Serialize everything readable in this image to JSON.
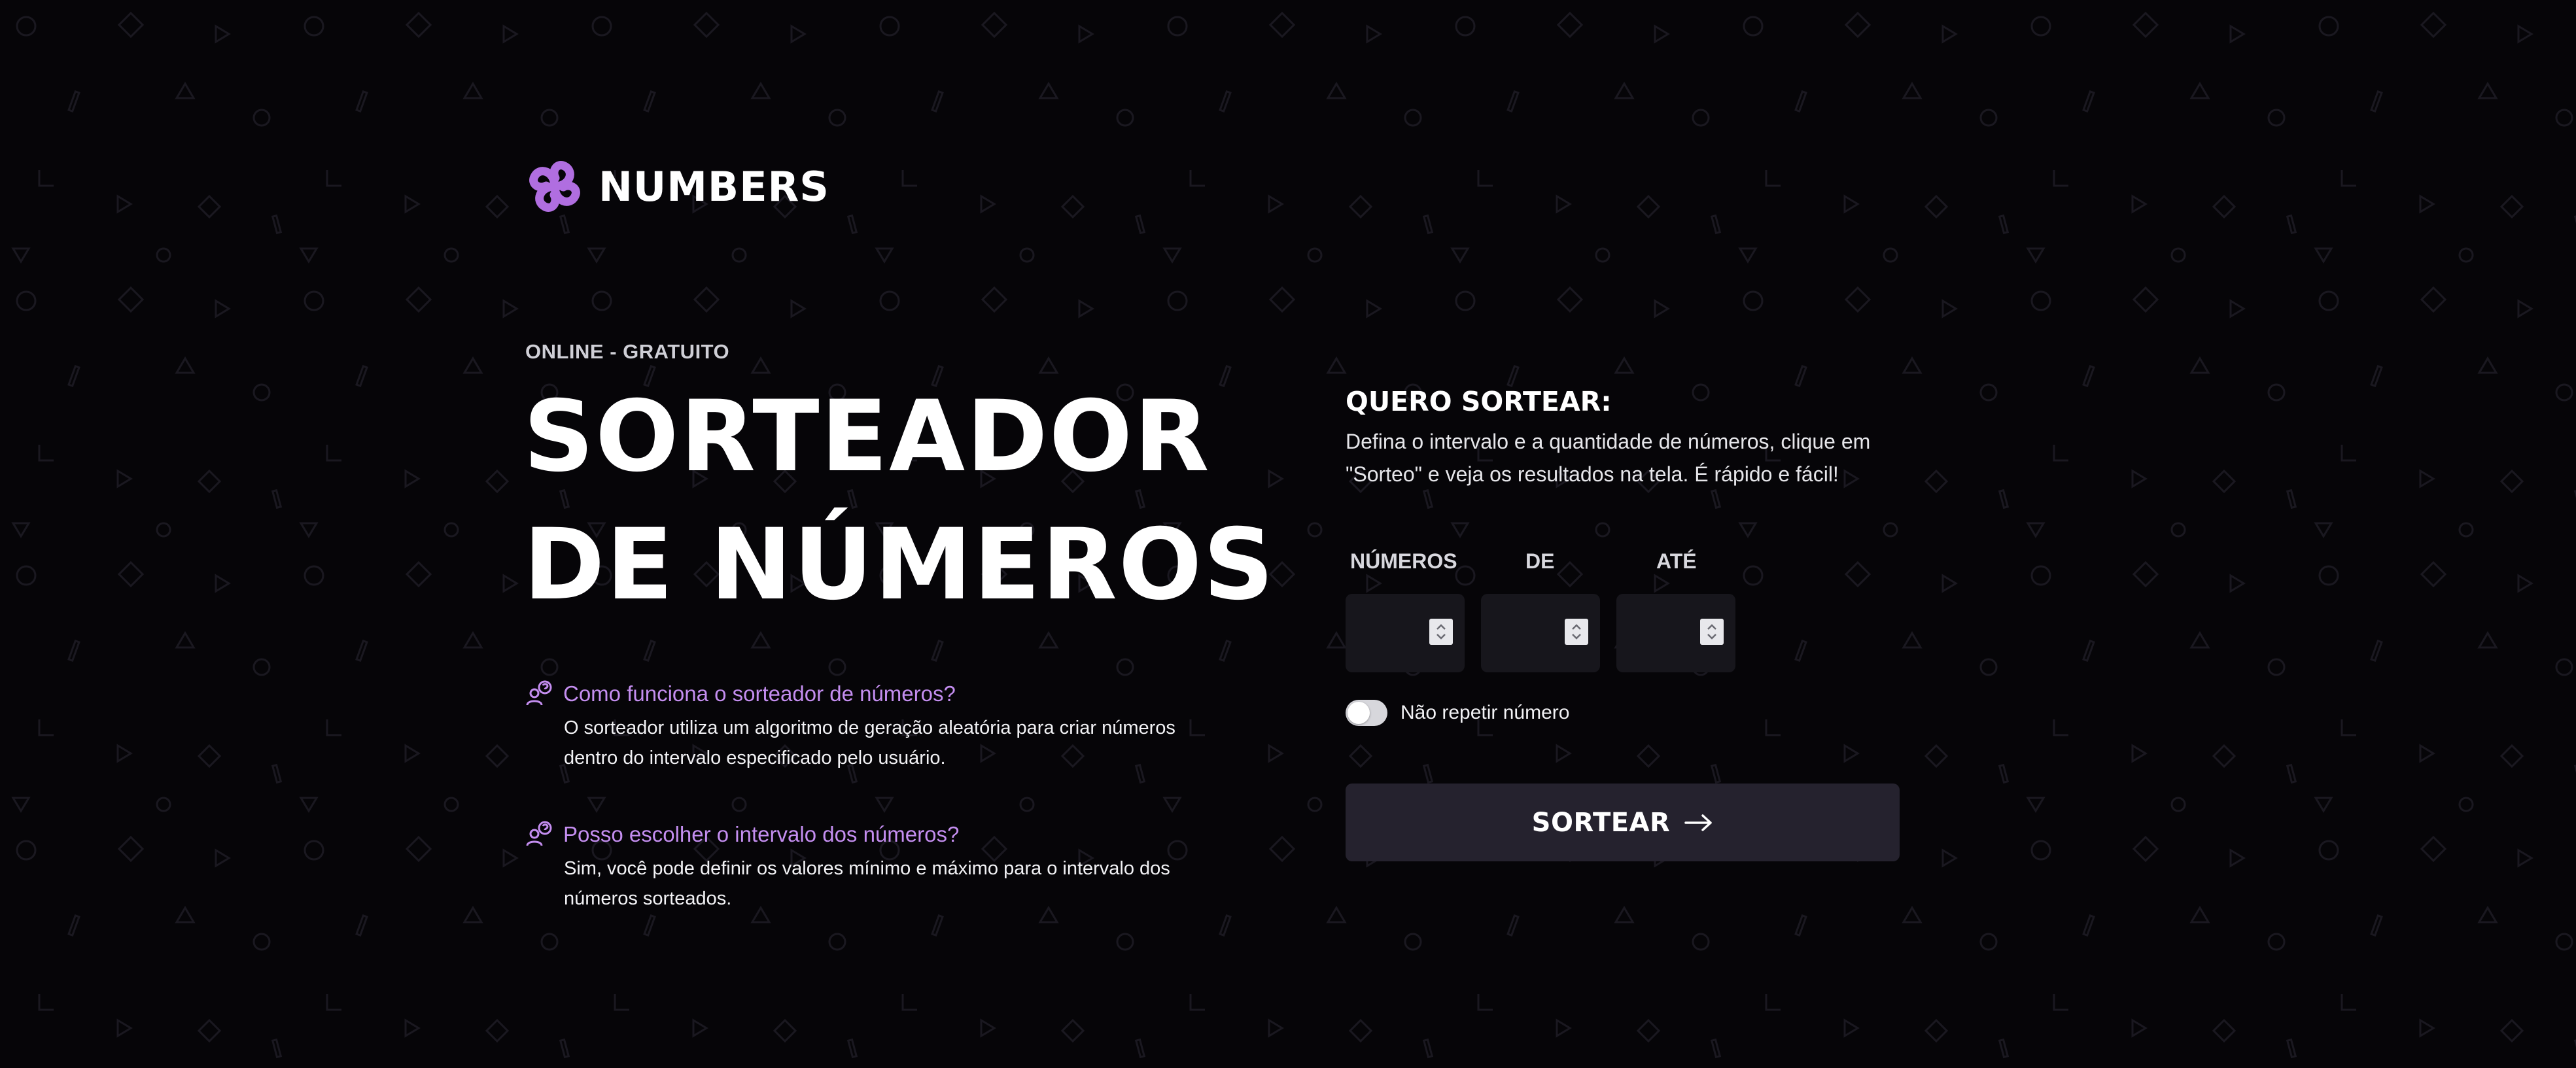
{
  "brand": {
    "name": "NUMBERS",
    "accent_color": "#b06ee0"
  },
  "hero": {
    "eyebrow": "ONLINE - GRATUITO",
    "title_line1": "SORTEADOR",
    "title_line2": "DE NÚMEROS"
  },
  "faq": [
    {
      "question": "Como funciona o sorteador de números?",
      "answer_line1": "O sorteador utiliza um algoritmo de geração aleatória para criar números",
      "answer_line2": "dentro do intervalo especificado pelo usuário.",
      "icon": "people-question-icon"
    },
    {
      "question": "Posso escolher o intervalo dos números?",
      "answer_line1": "Sim, você pode definir os valores mínimo e máximo para o intervalo dos",
      "answer_line2": "números sorteados.",
      "icon": "people-question-icon"
    }
  ],
  "form": {
    "title": "QUERO SORTEAR:",
    "description_line1": "Defina o intervalo e a quantidade de números, clique em",
    "description_line2": "\"Sorteo\" e veja os resultados na tela. É rápido e fácil!",
    "fields": [
      {
        "label": "NÚMEROS",
        "value": ""
      },
      {
        "label": "DE",
        "value": ""
      },
      {
        "label": "ATÉ",
        "value": ""
      }
    ],
    "toggle_label": "Não repetir número",
    "toggle_on": false,
    "submit_label": "SORTEAR",
    "submit_icon": "arrow-right-icon"
  },
  "colors": {
    "background": "#060508",
    "question_text": "#c48ef0",
    "input_bg": "#17161c",
    "button_bg": "#25222e"
  }
}
